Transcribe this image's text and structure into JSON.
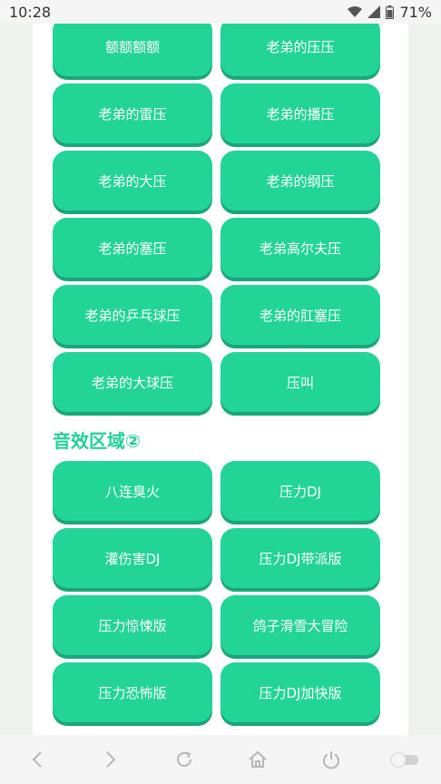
{
  "status_bar": {
    "time": "10:28",
    "battery": "71%"
  },
  "section1": {
    "buttons": [
      "额额额额",
      "老弟的压压",
      "老弟的雷压",
      "老弟的播压",
      "老弟的大压",
      "老弟的纲压",
      "老弟的塞压",
      "老弟高尔夫压",
      "老弟的乒乓球压",
      "老弟的肛塞压",
      "老弟的大球压",
      "压叫"
    ]
  },
  "section2": {
    "title": "音效区域②",
    "buttons": [
      "八连臭火",
      "压力DJ",
      "灌伤害DJ",
      "压力DJ带派版",
      "压力惊悚版",
      "鸽子滑雪大冒险",
      "压力恐怖版",
      "压力DJ加快版"
    ]
  },
  "colors": {
    "button": "#22d596",
    "button_shadow": "#1ba57a",
    "section_title": "#22cf96"
  },
  "nav": {
    "icons": [
      "back-icon",
      "forward-icon",
      "refresh-icon",
      "home-icon",
      "power-icon",
      "toggle-icon"
    ]
  }
}
